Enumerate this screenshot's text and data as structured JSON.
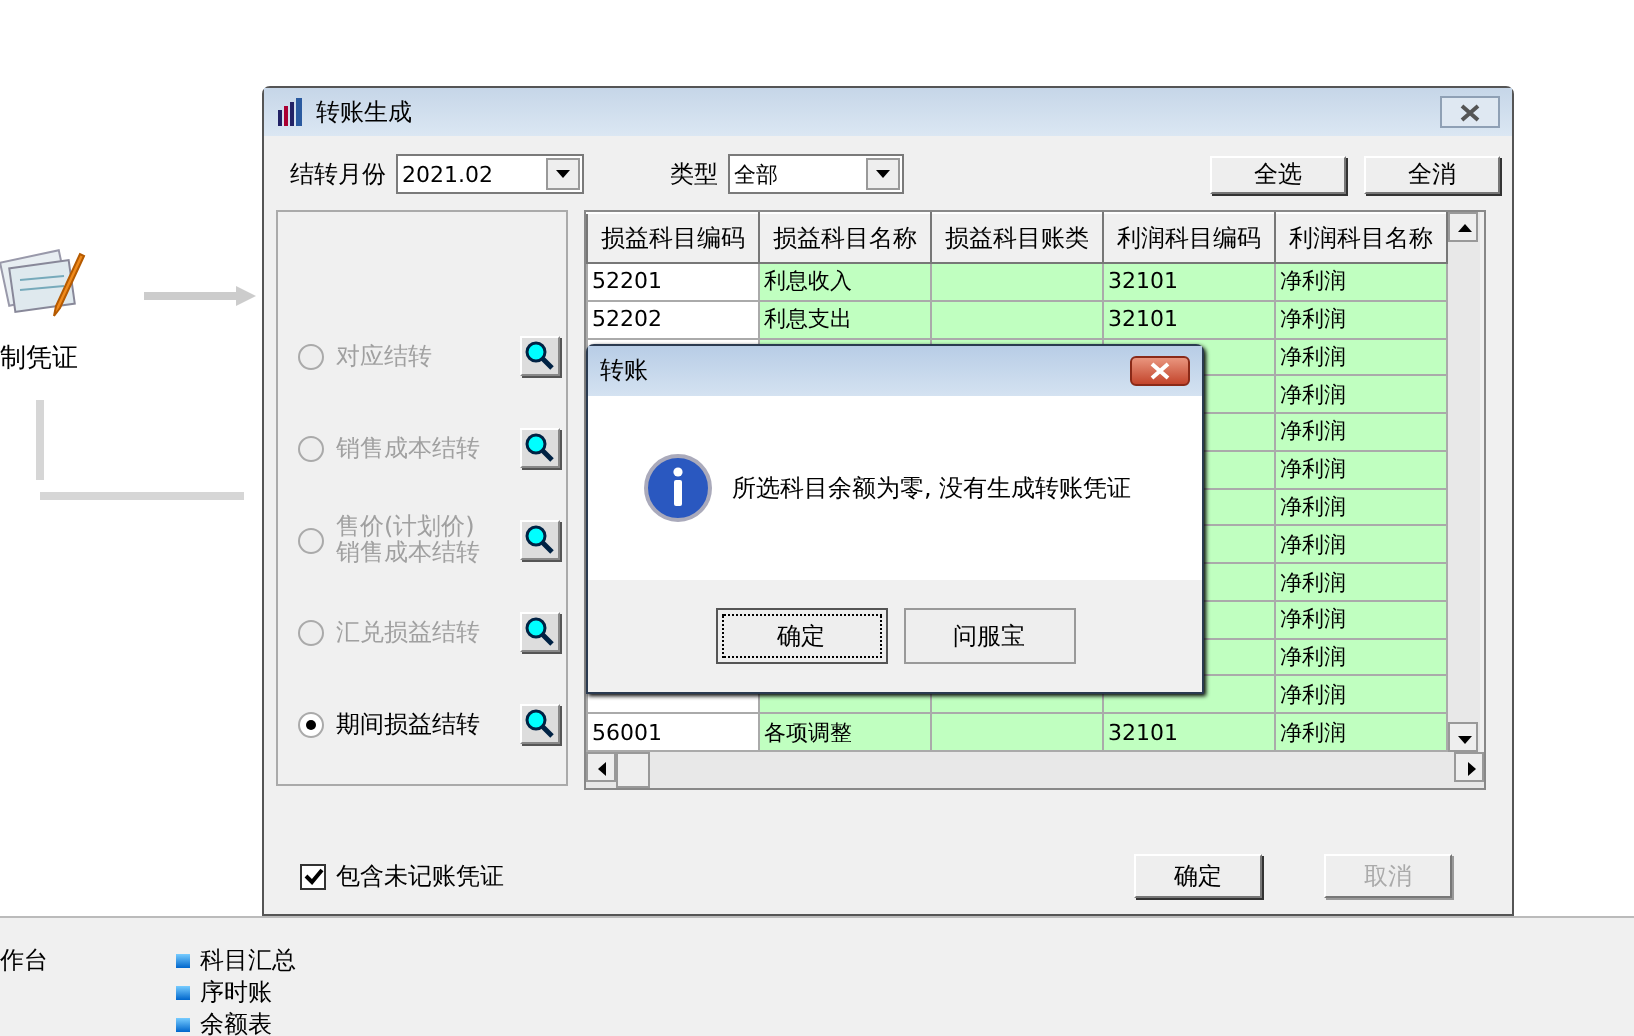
{
  "background": {
    "node_label": "制凭证",
    "workbench_label": "作台",
    "report_items": [
      "科目汇总",
      "序时账",
      "余额表"
    ]
  },
  "window": {
    "title": "转账生成",
    "month": {
      "label": "结转月份",
      "value": "2021.02"
    },
    "type": {
      "label": "类型",
      "value": "全部"
    },
    "select_all": "全选",
    "clear_all": "全消",
    "options": [
      {
        "lines": [
          "对应结转"
        ],
        "disabled": true,
        "selected": false
      },
      {
        "lines": [
          "销售成本结转"
        ],
        "disabled": true,
        "selected": false
      },
      {
        "lines": [
          "售价(计划价)",
          "销售成本结转"
        ],
        "disabled": true,
        "selected": false
      },
      {
        "lines": [
          "汇兑损益结转"
        ],
        "disabled": true,
        "selected": false
      },
      {
        "lines": [
          "期间损益结转"
        ],
        "disabled": false,
        "selected": true
      }
    ],
    "table": {
      "columns": [
        "损益科目编码",
        "损益科目名称",
        "损益科目账类",
        "利润科目编码",
        "利润科目名称"
      ],
      "rows": [
        {
          "code": "52201",
          "name": "利息收入",
          "profit_code": "32101",
          "profit_name": "净利润"
        },
        {
          "code": "52202",
          "name": "利息支出",
          "profit_code": "32101",
          "profit_name": "净利润"
        },
        {
          "profit_name": "净利润"
        },
        {
          "profit_name": "净利润"
        },
        {
          "profit_name": "净利润"
        },
        {
          "profit_name": "净利润"
        },
        {
          "profit_name": "净利润"
        },
        {
          "profit_name": "净利润"
        },
        {
          "profit_name": "净利润"
        },
        {
          "profit_name": "净利润"
        },
        {
          "profit_name": "净利润"
        },
        {
          "profit_name": "净利润"
        },
        {
          "code": "56001",
          "name": "各项调整",
          "profit_code": "32101",
          "profit_name": "净利润"
        }
      ]
    },
    "include_unposted": {
      "label": "包含未记账凭证",
      "checked": true
    },
    "ok": {
      "label": "确定",
      "disabled": false
    },
    "cancel": {
      "label": "取消",
      "disabled": true
    }
  },
  "message_box": {
    "title": "转账",
    "message": "所选科目余额为零, 没有生成转账凭证",
    "buttons": [
      "确定",
      "问服宝"
    ]
  }
}
